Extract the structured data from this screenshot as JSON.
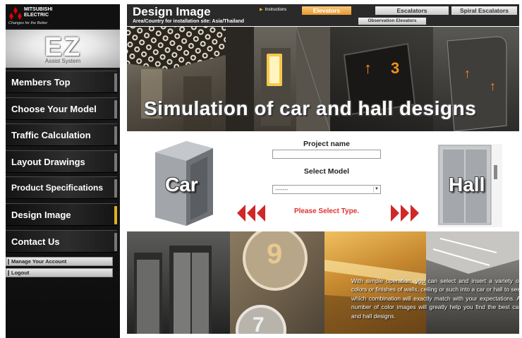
{
  "brand": {
    "name": "MITSUBISHI ELECTRIC",
    "tagline": "Changes for the Better",
    "logo_text": "EZ",
    "logo_subtitle": "Assist System"
  },
  "sidebar": {
    "items": [
      {
        "label": "Members Top",
        "active": false
      },
      {
        "label": "Choose Your Model",
        "active": false
      },
      {
        "label": "Traffic Calculation",
        "active": false
      },
      {
        "label": "Layout Drawings",
        "active": false
      },
      {
        "label": "Product Specifications",
        "active": false
      },
      {
        "label": "Design Image",
        "active": true
      },
      {
        "label": "Contact Us",
        "active": false
      }
    ],
    "links": [
      {
        "label": "Manage Your Account"
      },
      {
        "label": "Logout"
      }
    ],
    "accent_color": "#e0b020"
  },
  "header": {
    "title": "Design Image",
    "subtitle": "Area/Country for installation site: Asia/Thailand",
    "instructions_label": "Instructions",
    "tabs": {
      "elevators": "Elevators",
      "escalators": "Escalators",
      "spiral": "Spiral Escalators",
      "observation": "Observation Elevators"
    },
    "active_tab": "Elevators",
    "active_tab_color": "#e89830"
  },
  "hero": {
    "heading": "Simulation of car and hall designs",
    "panel_glyphs": {
      "p3_left": "↑",
      "p3_right": "3",
      "p4_top": "↑",
      "p4_side": "↑"
    }
  },
  "middle": {
    "car_label": "Car",
    "hall_label": "Hall",
    "project_name_label": "Project name",
    "project_name_value": "",
    "select_model_label": "Select Model",
    "select_model_value": "-------",
    "status_message": "Please Select Type.",
    "status_color": "#e03030",
    "arrow_color": "#d02828"
  },
  "bottom": {
    "panel_digits": {
      "top": "9",
      "bottom": "7"
    },
    "description": "With simple operation, you can select and insert a variety of colors or finishes of walls, ceiling or such into a car or hall to see which combination will exactly match with your expectations. A number of color images will greatly help you find the best car and hall designs."
  }
}
